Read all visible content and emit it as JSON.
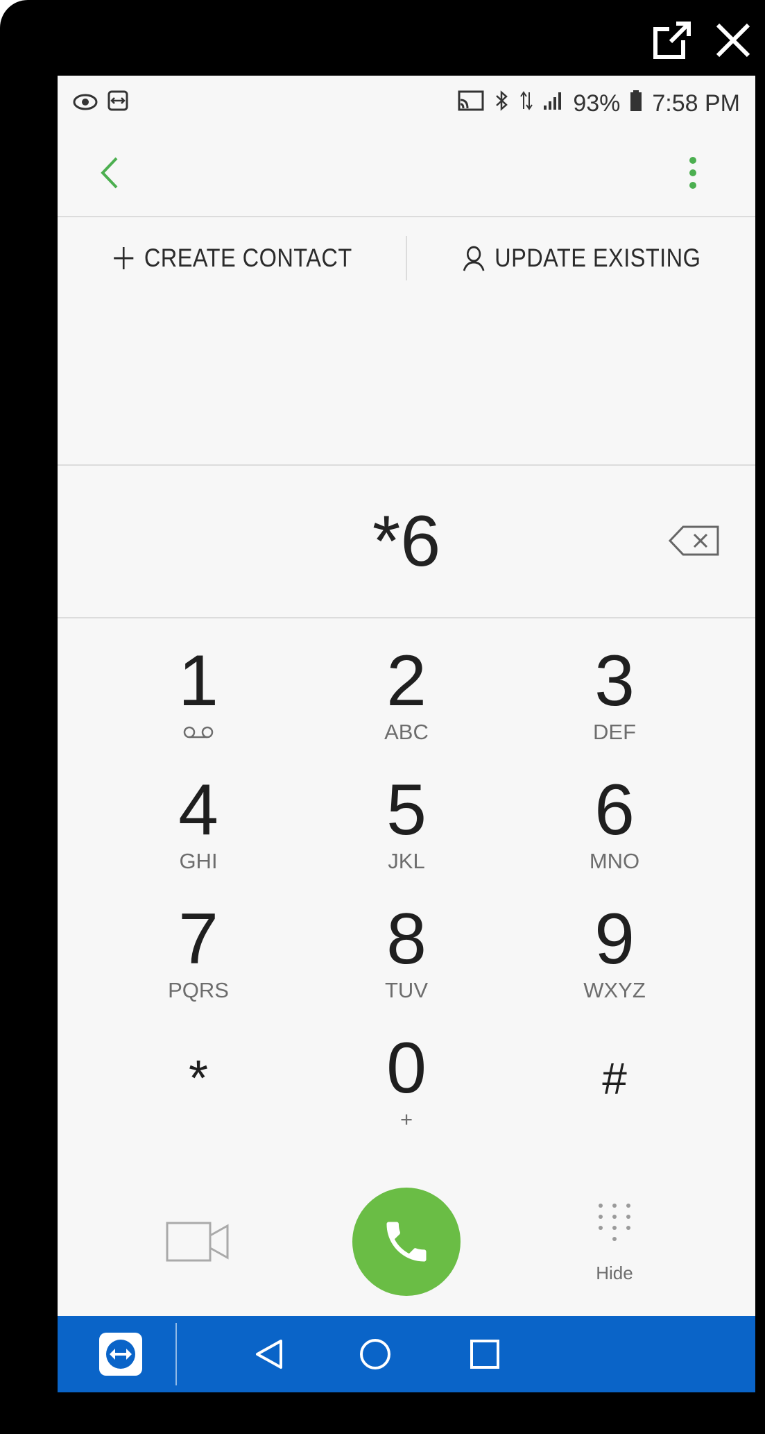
{
  "status_bar": {
    "left_icons": [
      "eye-icon",
      "teamviewer-small-icon"
    ],
    "right_icons": [
      "cast-icon",
      "bluetooth-icon",
      "data-arrows-icon",
      "signal-icon"
    ],
    "battery": "93%",
    "time": "7:58 PM"
  },
  "window_controls": {
    "icons": [
      "open-external-icon",
      "close-icon"
    ]
  },
  "app_bar": {
    "back_icon": "chevron-left-icon",
    "more_icon": "more-vert-icon",
    "accent_color": "#4caf50"
  },
  "actions": {
    "create_contact": "CREATE CONTACT",
    "update_existing": "UPDATE EXISTING"
  },
  "dialer": {
    "number": "*6",
    "backspace_icon": "backspace-icon"
  },
  "keypad": {
    "keys": [
      {
        "digit": "1",
        "sub": "voicemail-icon"
      },
      {
        "digit": "2",
        "sub": "ABC"
      },
      {
        "digit": "3",
        "sub": "DEF"
      },
      {
        "digit": "4",
        "sub": "GHI"
      },
      {
        "digit": "5",
        "sub": "JKL"
      },
      {
        "digit": "6",
        "sub": "MNO"
      },
      {
        "digit": "7",
        "sub": "PQRS"
      },
      {
        "digit": "8",
        "sub": "TUV"
      },
      {
        "digit": "9",
        "sub": "WXYZ"
      },
      {
        "digit": "*",
        "sub": ""
      },
      {
        "digit": "0",
        "sub": "+"
      },
      {
        "digit": "#",
        "sub": ""
      }
    ]
  },
  "bottom": {
    "video_icon": "video-call-icon",
    "call_icon": "phone-icon",
    "call_color": "#6abd45",
    "hide_label": "Hide"
  },
  "nav_bar": {
    "color": "#0a64c8",
    "icons": [
      "teamviewer-icon",
      "back-triangle-icon",
      "home-circle-icon",
      "recents-square-icon"
    ]
  }
}
